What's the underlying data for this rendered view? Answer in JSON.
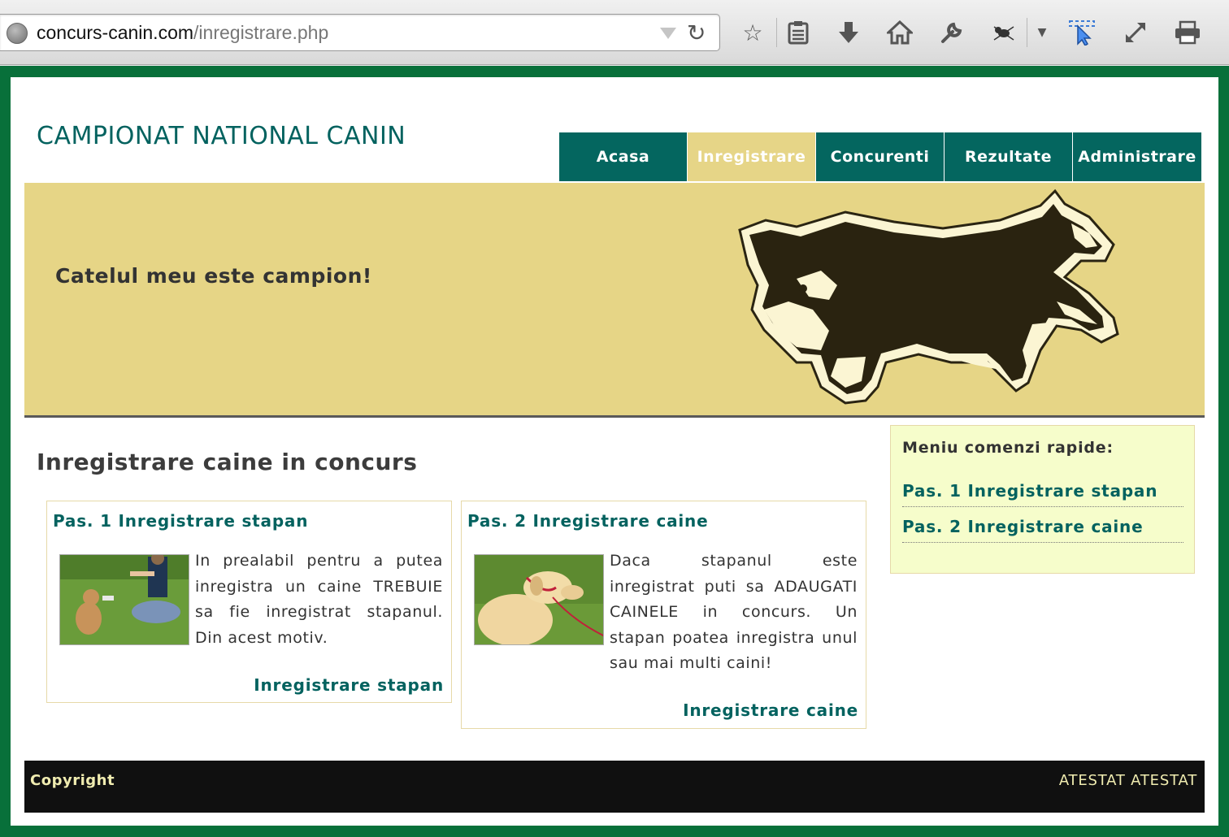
{
  "browser": {
    "url_domain": "concurs-canin.com",
    "url_path": "/inregistrare.php"
  },
  "site": {
    "title": "CAMPIONAT NATIONAL CANIN",
    "slogan": "Catelul meu este campion!"
  },
  "nav": {
    "items": [
      {
        "label": "Acasa",
        "active": false
      },
      {
        "label": "Inregistrare",
        "active": true
      },
      {
        "label": "Concurenti",
        "active": false
      },
      {
        "label": "Rezultate",
        "active": false
      },
      {
        "label": "Administrare",
        "active": false
      }
    ]
  },
  "main": {
    "title": "Inregistrare caine in concurs",
    "cards": [
      {
        "title": "Pas. 1 Inregistrare stapan",
        "text": "In prealabil pentru a putea inregistra un caine TREBUIE sa fie inregistrat stapanul. Din acest motiv.",
        "link": "Inregistrare stapan"
      },
      {
        "title": "Pas. 2 Inregistrare caine",
        "text": "Daca stapanul este inregistrat puti sa ADAUGATI CAINELE in concurs. Un stapan poatea inregistra unul sau mai multi caini!",
        "link": "Inregistrare caine"
      }
    ]
  },
  "quick_menu": {
    "title": "Meniu comenzi rapide:",
    "items": [
      "Pas. 1 Inregistrare stapan",
      "Pas. 2 Inregistrare caine"
    ]
  },
  "footer": {
    "left": "Copyright",
    "right": "ATESTAT ATESTAT"
  },
  "colors": {
    "frame": "#08703a",
    "nav": "#04665f",
    "nav_active": "#e6d587",
    "banner": "#e6d586",
    "link": "#03625f",
    "quick_bg": "#f6fdcb",
    "footer_bg": "#101010"
  },
  "icons": {
    "toolbar": [
      "bookmark-star-icon",
      "reading-list-icon",
      "download-icon",
      "home-icon",
      "wrench-icon",
      "bug-extension-icon",
      "dropdown-arrow-icon",
      "pointer-icon",
      "fullscreen-icon",
      "print-icon"
    ]
  }
}
